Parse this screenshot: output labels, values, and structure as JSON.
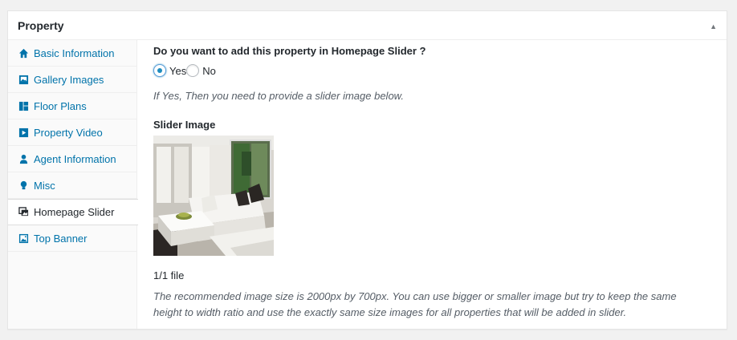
{
  "metabox": {
    "title": "Property",
    "toggle_icon": "arrow-up-icon"
  },
  "tabs": [
    {
      "label": "Basic Information",
      "icon": "home-icon"
    },
    {
      "label": "Gallery Images",
      "icon": "gallery-icon"
    },
    {
      "label": "Floor Plans",
      "icon": "floor-plan-icon"
    },
    {
      "label": "Property Video",
      "icon": "video-icon"
    },
    {
      "label": "Agent Information",
      "icon": "person-icon"
    },
    {
      "label": "Misc",
      "icon": "lightbulb-icon"
    },
    {
      "label": "Homepage Slider",
      "icon": "images-icon",
      "active": true
    },
    {
      "label": "Top Banner",
      "icon": "banner-icon"
    }
  ],
  "slider": {
    "question": "Do you want to add this property in Homepage Slider ?",
    "options": [
      {
        "label": "Yes",
        "checked": true
      },
      {
        "label": "No",
        "checked": false
      }
    ],
    "hint": "If Yes, Then you need to provide a slider image below.",
    "image_label": "Slider Image",
    "file_count": "1/1 file",
    "recommendation_line1": "The recommended image size is 2000px by 700px. You can use bigger or smaller image but try to keep the same",
    "recommendation_line2": "height to width ratio and use the exactly same size images for all properties that will be added in slider."
  },
  "colors": {
    "link": "#0073aa",
    "text": "#23282d",
    "muted": "#555d66",
    "radio_checked": "#1e8cbe"
  }
}
